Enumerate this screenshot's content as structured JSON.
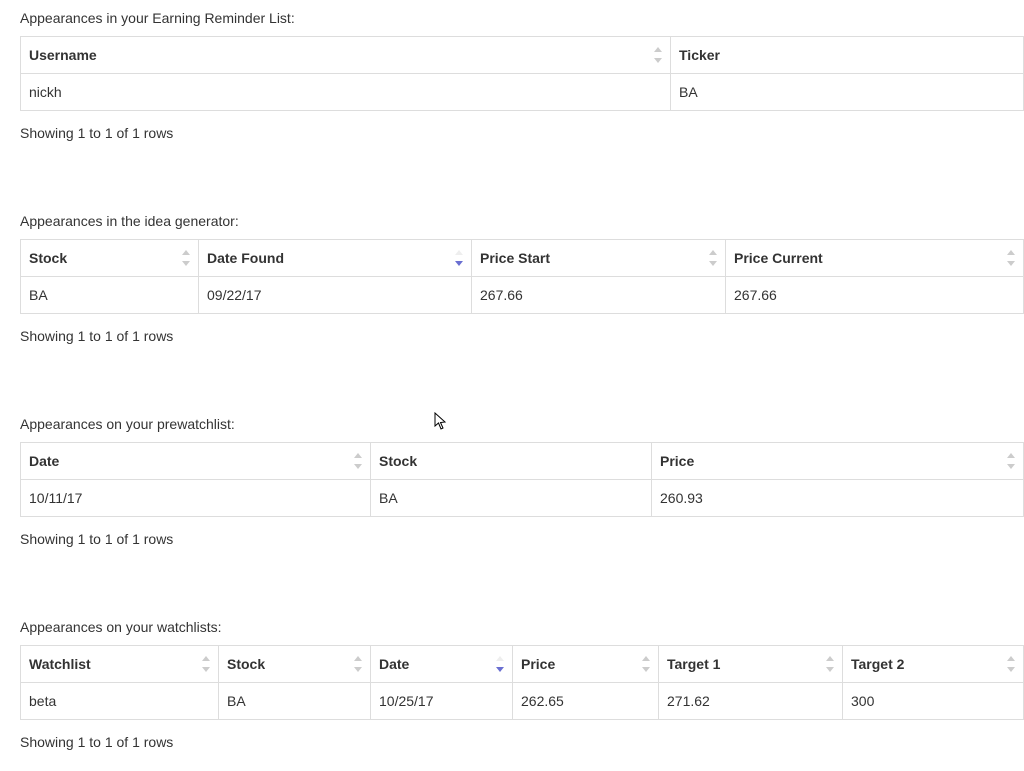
{
  "sections": {
    "earning": {
      "caption": "Appearances in your Earning Reminder List:",
      "headers": {
        "username": "Username",
        "ticker": "Ticker"
      },
      "row": {
        "username": "nickh",
        "ticker": "BA"
      },
      "footer": "Showing 1 to 1 of 1 rows"
    },
    "idea": {
      "caption": "Appearances in the idea generator:",
      "headers": {
        "stock": "Stock",
        "date_found": "Date Found",
        "price_start": "Price Start",
        "price_current": "Price Current"
      },
      "row": {
        "stock": "BA",
        "date_found": "09/22/17",
        "price_start": "267.66",
        "price_current": "267.66"
      },
      "footer": "Showing 1 to 1 of 1 rows"
    },
    "prewatch": {
      "caption": "Appearances on your prewatchlist:",
      "headers": {
        "date": "Date",
        "stock": "Stock",
        "price": "Price"
      },
      "row": {
        "date": "10/11/17",
        "stock": "BA",
        "price": "260.93"
      },
      "footer": "Showing 1 to 1 of 1 rows"
    },
    "watch": {
      "caption": "Appearances on your watchlists:",
      "headers": {
        "watchlist": "Watchlist",
        "stock": "Stock",
        "date": "Date",
        "price": "Price",
        "target1": "Target 1",
        "target2": "Target 2"
      },
      "row": {
        "watchlist": "beta",
        "stock": "BA",
        "date": "10/25/17",
        "price": "262.65",
        "target1": "271.62",
        "target2": "300"
      },
      "footer": "Showing 1 to 1 of 1 rows"
    }
  }
}
